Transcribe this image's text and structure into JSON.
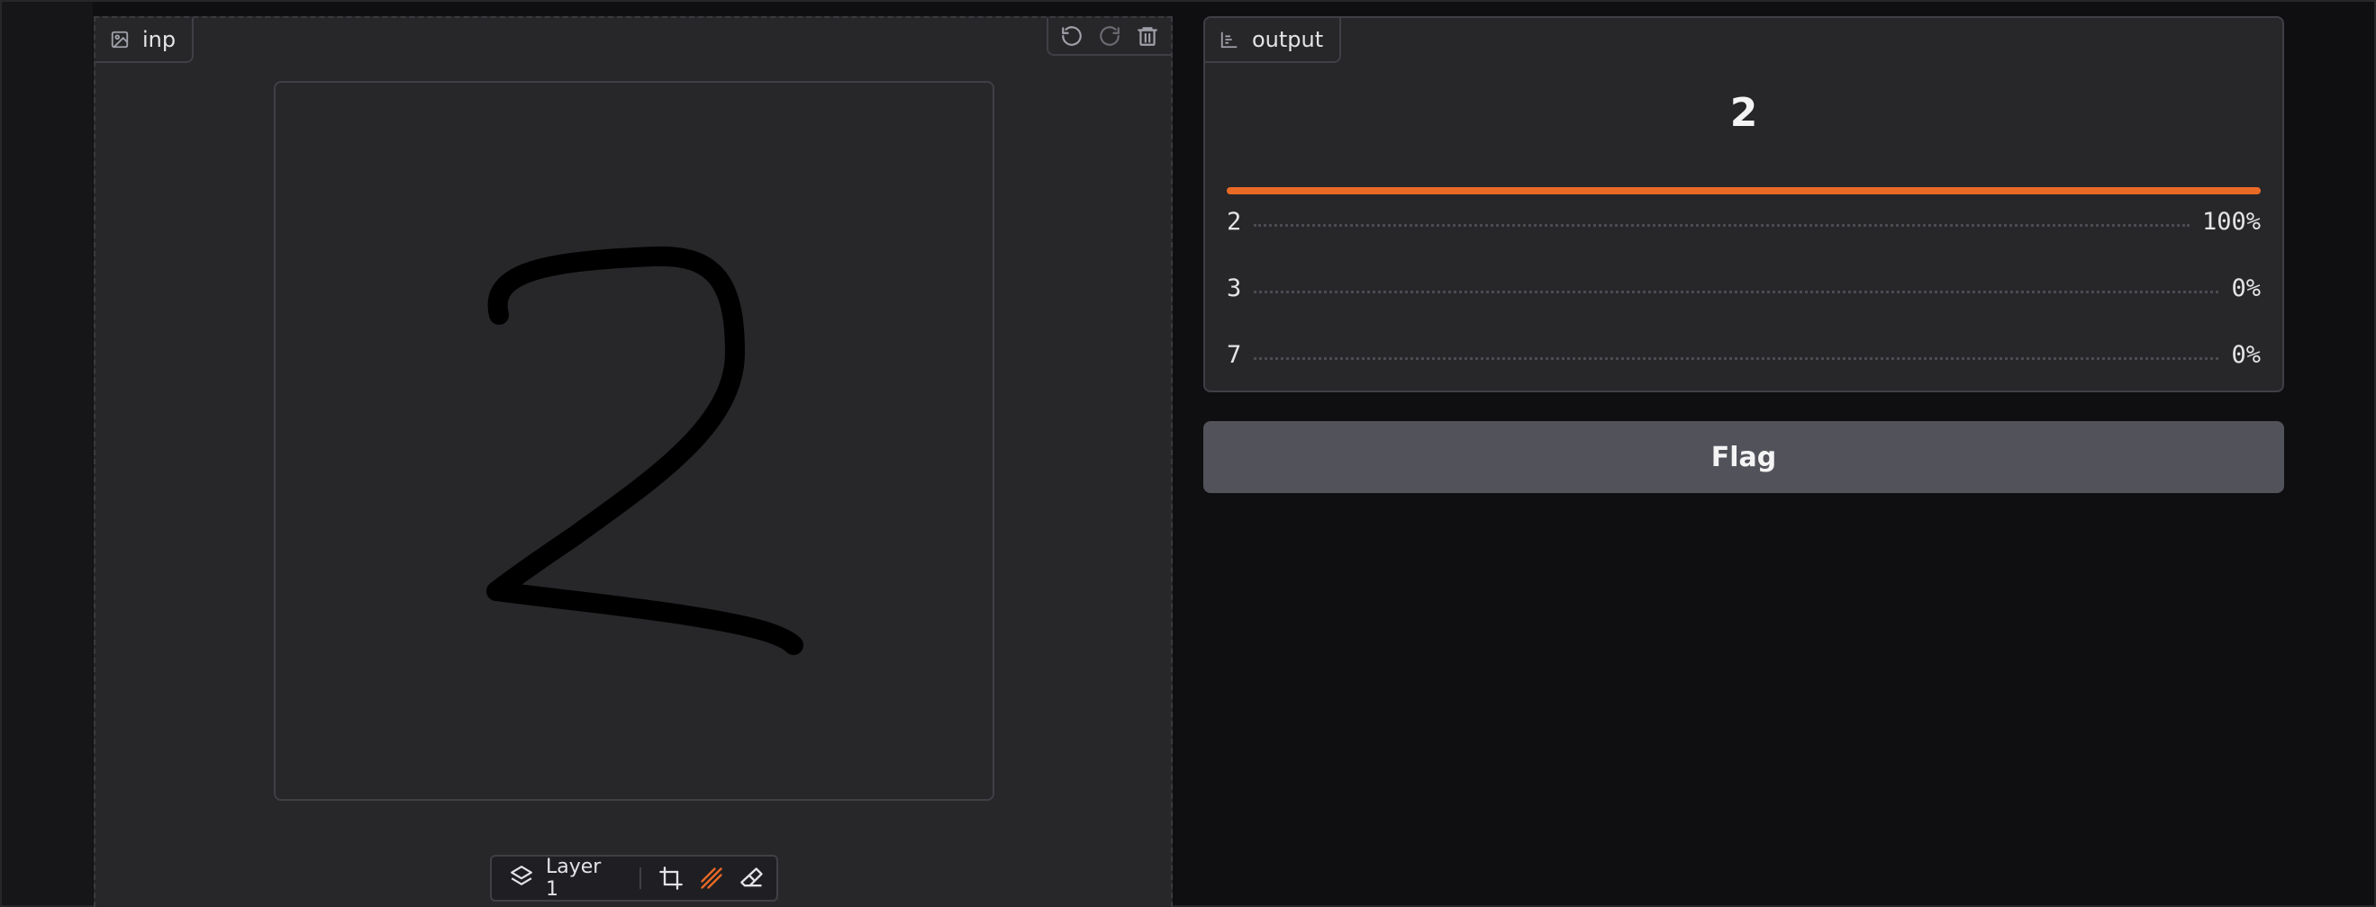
{
  "input": {
    "label": "inp",
    "label_icon": "image-icon",
    "tools": [
      "undo-icon",
      "redo-icon",
      "trash-icon"
    ],
    "toolbar": {
      "layer_label": "Layer 1",
      "icons": [
        "layers-icon",
        "crop-icon",
        "brush-icon",
        "eraser-icon"
      ],
      "active_tool": "brush-icon"
    },
    "drawing": "handwritten digit 2"
  },
  "output": {
    "label": "output",
    "label_icon": "bar-chart-icon",
    "top_prediction": "2",
    "confidences": [
      {
        "label": "2",
        "value": "100%",
        "fraction": 1.0
      },
      {
        "label": "3",
        "value": "0%",
        "fraction": 0.0
      },
      {
        "label": "7",
        "value": "0%",
        "fraction": 0.0
      }
    ],
    "accent_color": "#ea6a25"
  },
  "flag_button": {
    "label": "Flag"
  }
}
